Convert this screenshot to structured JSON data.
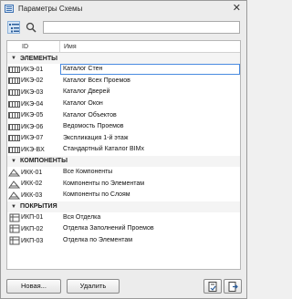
{
  "window": {
    "title": "Параметры Схемы",
    "close_glyph": "✕"
  },
  "toolbar": {
    "list_icon": "list-view-icon",
    "search_icon": "search-icon",
    "search_value": ""
  },
  "table": {
    "col_id": "ID",
    "col_name": "Имя"
  },
  "groups": [
    {
      "label": "ЭЛЕМЕНТЫ",
      "icon": "schedule-element-icon",
      "rows": [
        {
          "id": "ИКЭ-01",
          "name": "Каталог Стен",
          "selected": true
        },
        {
          "id": "ИКЭ-02",
          "name": "Каталог Всех Проемов"
        },
        {
          "id": "ИКЭ-03",
          "name": "Каталог Дверей"
        },
        {
          "id": "ИКЭ-04",
          "name": "Каталог Окон"
        },
        {
          "id": "ИКЭ-05",
          "name": "Каталог Объектов"
        },
        {
          "id": "ИКЭ-06",
          "name": "Ведомость Проемов"
        },
        {
          "id": "ИКЭ-07",
          "name": "Экспликация 1-й этаж"
        },
        {
          "id": "ИКЭ-BX",
          "name": "Стандартный Каталог BIMx"
        }
      ]
    },
    {
      "label": "КОМПОНЕНТЫ",
      "icon": "schedule-component-icon",
      "rows": [
        {
          "id": "ИКК-01",
          "name": "Все Компоненты"
        },
        {
          "id": "ИКК-02",
          "name": "Компоненты по Элементам"
        },
        {
          "id": "ИКК-03",
          "name": "Компоненты по Слоям"
        }
      ]
    },
    {
      "label": "ПОКРЫТИЯ",
      "icon": "schedule-surface-icon",
      "rows": [
        {
          "id": "ИКП-01",
          "name": "Вся Отделка"
        },
        {
          "id": "ИКП-02",
          "name": "Отделка Заполнений Проемов"
        },
        {
          "id": "ИКП-03",
          "name": "Отделка по Элементам"
        }
      ]
    }
  ],
  "buttons": {
    "new_label": "Новая...",
    "delete_label": "Удалить"
  }
}
